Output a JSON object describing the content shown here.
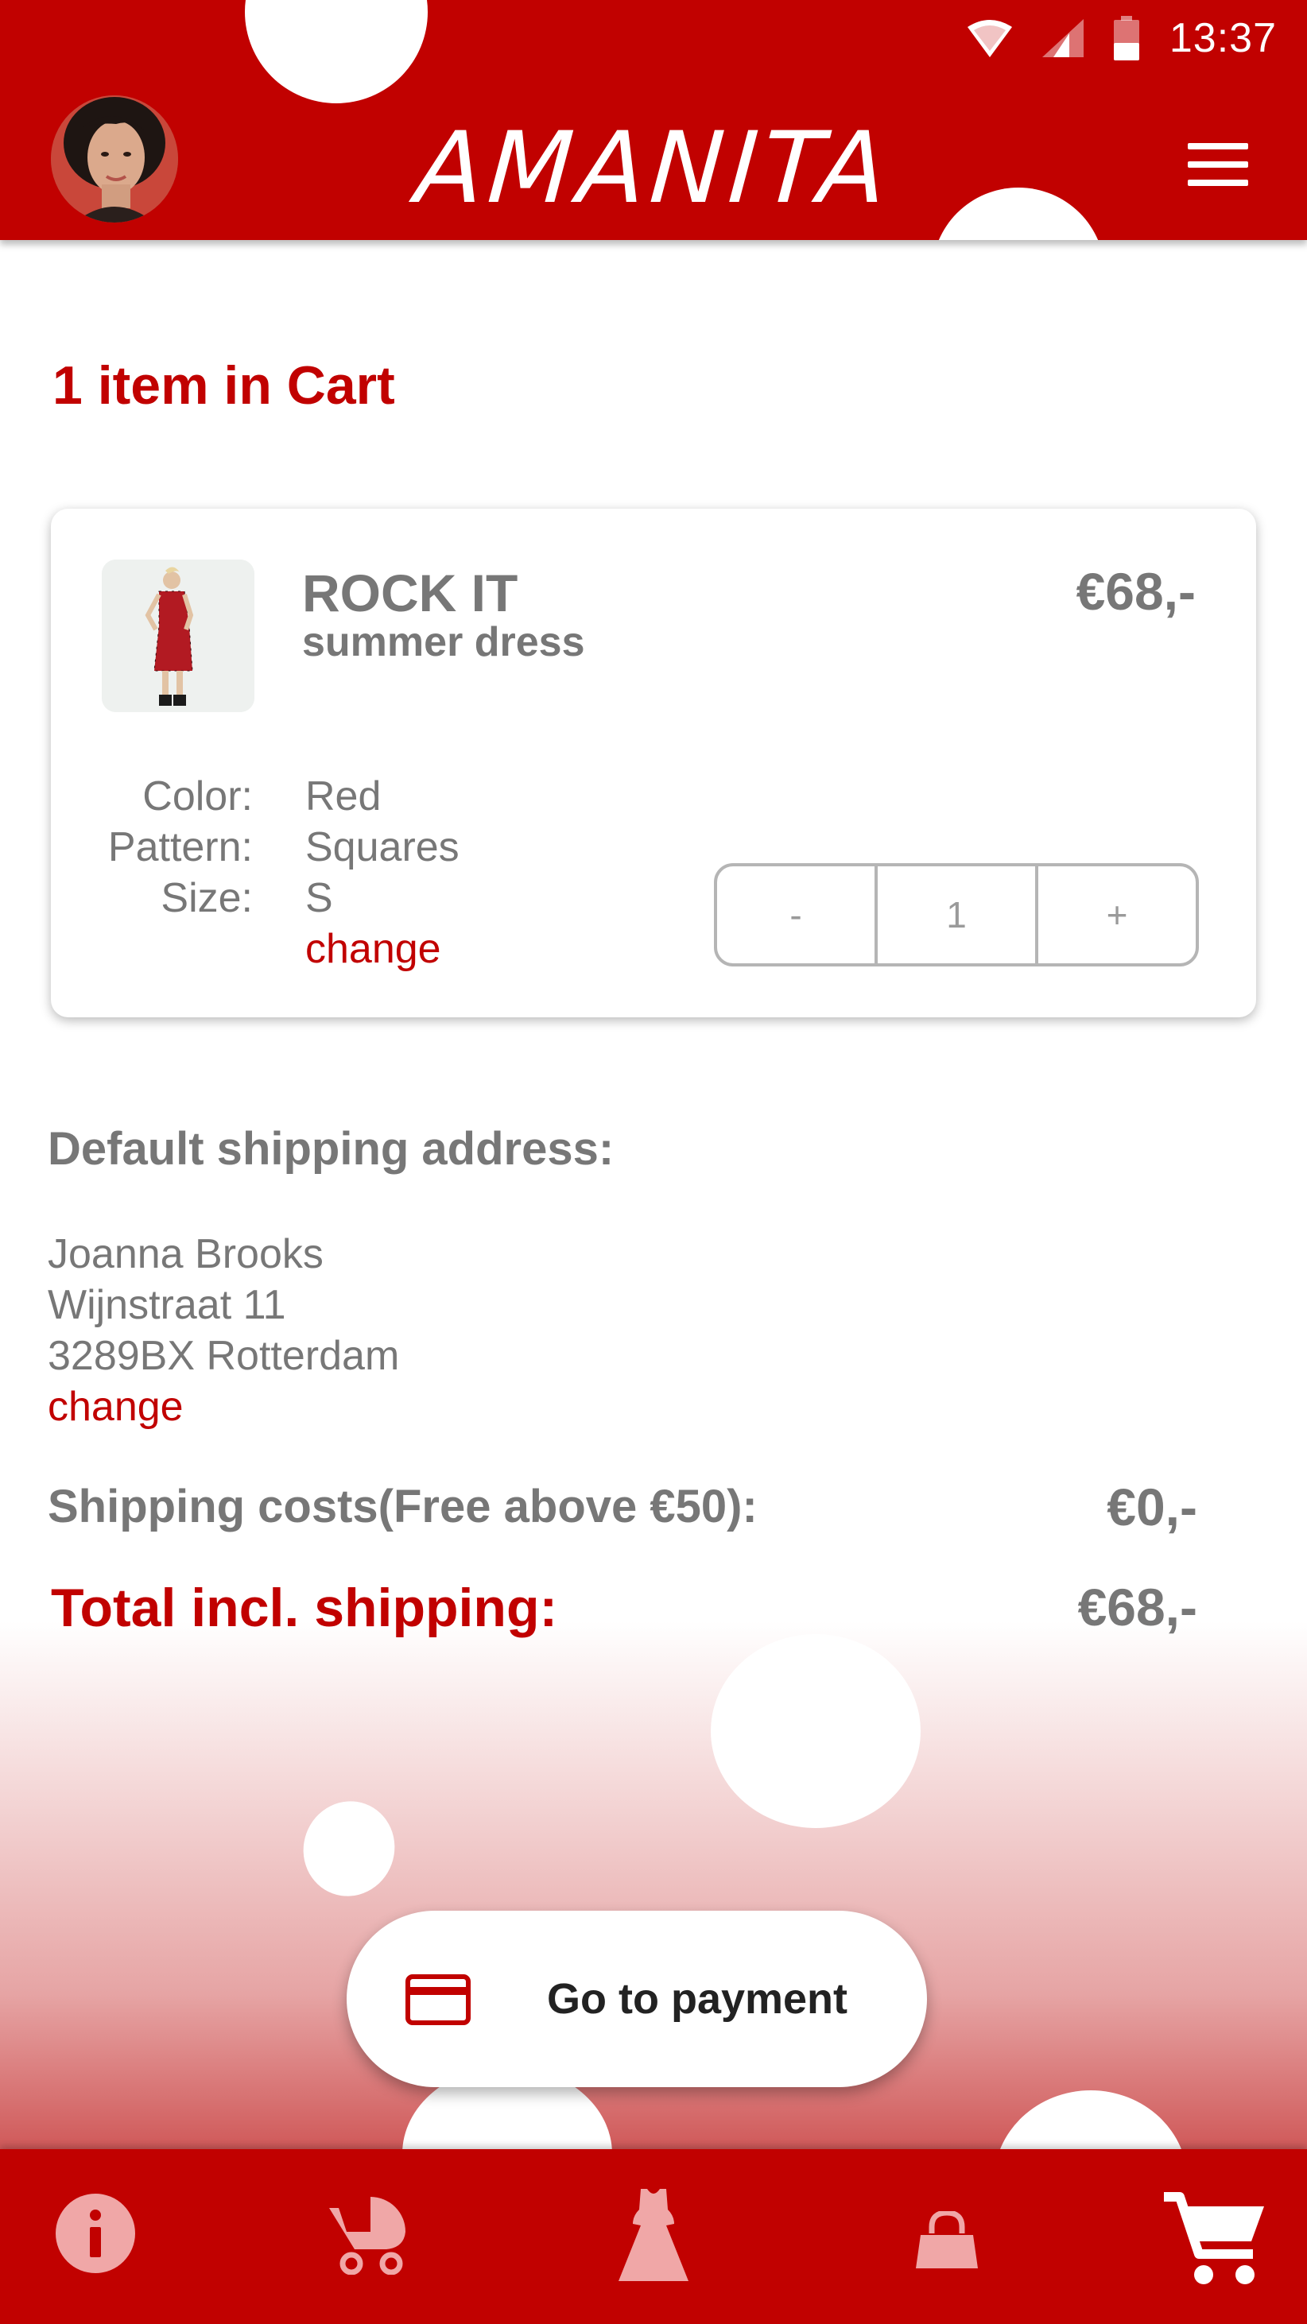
{
  "app": {
    "brand": "AMANITA"
  },
  "status_bar": {
    "time": "13:37"
  },
  "cart": {
    "title": "1 item in Cart"
  },
  "item": {
    "name": "ROCK IT",
    "subtitle": "summer dress",
    "price": "€68,-",
    "attr_labels": [
      "Color:",
      "Pattern:",
      "Size:"
    ],
    "attr_values": [
      "Red",
      "Squares",
      "S"
    ],
    "change_label": "change",
    "quantity": {
      "decrement": "-",
      "value": "1",
      "increment": "+"
    }
  },
  "shipping": {
    "heading": "Default shipping address:",
    "name": "Joanna Brooks",
    "street": "Wijnstraat 11",
    "city": "3289BX Rotterdam",
    "change_label": "change",
    "cost_label": "Shipping costs(Free above €50):",
    "cost_value": "€0,-",
    "total_label": "Total incl. shipping:",
    "total_value": "€68,-"
  },
  "payment_button": {
    "label": "Go to payment",
    "icon": "credit-card-icon"
  },
  "bottom_nav": {
    "items": [
      {
        "icon": "info-icon",
        "active": false
      },
      {
        "icon": "stroller-icon",
        "active": false
      },
      {
        "icon": "dress-icon",
        "active": false
      },
      {
        "icon": "bag-icon",
        "active": false
      },
      {
        "icon": "cart-icon",
        "active": true
      }
    ]
  },
  "colors": {
    "brand_red": "#c10100",
    "inactive_nav_icon": "#f0a7a7",
    "text_gray": "#777777"
  }
}
